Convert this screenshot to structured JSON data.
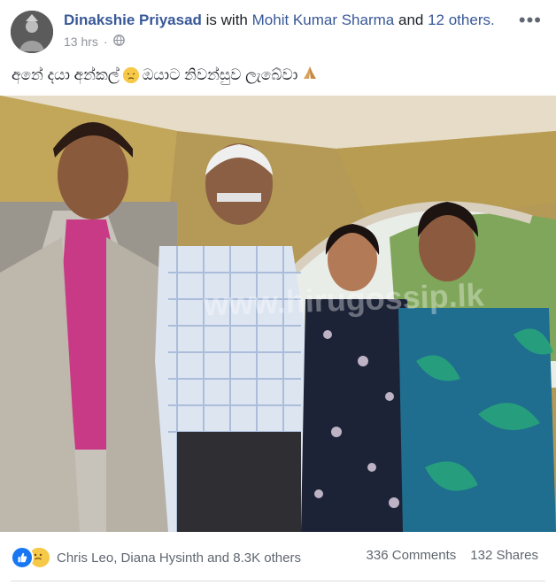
{
  "post": {
    "author": "Dinakshie Priyasad",
    "with_prefix": "is with",
    "tagged_person": "Mohit Kumar Sharma",
    "and_word": "and",
    "others_link": "12 others.",
    "time": "13 hrs",
    "audience_icon": "globe-icon",
    "caption_text": "අනේ දයා අන්කල්",
    "caption_text2": "ඔයාට නිවන්සුව ලැබේවා",
    "caption_emoji1": "sad-face-emoji",
    "caption_emoji2": "folded-hands-emoji",
    "more_label": "•••"
  },
  "photo": {
    "watermark": "www.hirugossip.lk"
  },
  "footer": {
    "reactors": "Chris Leo, Diana Hysinth and 8.3K others",
    "comments": "336 Comments",
    "shares": "132 Shares",
    "reaction_icons": [
      "like-icon",
      "sad-icon"
    ]
  },
  "colors": {
    "link": "#385898",
    "meta": "#90949c",
    "like_blue": "#1877f2",
    "emoji_yellow": "#f7c948"
  }
}
